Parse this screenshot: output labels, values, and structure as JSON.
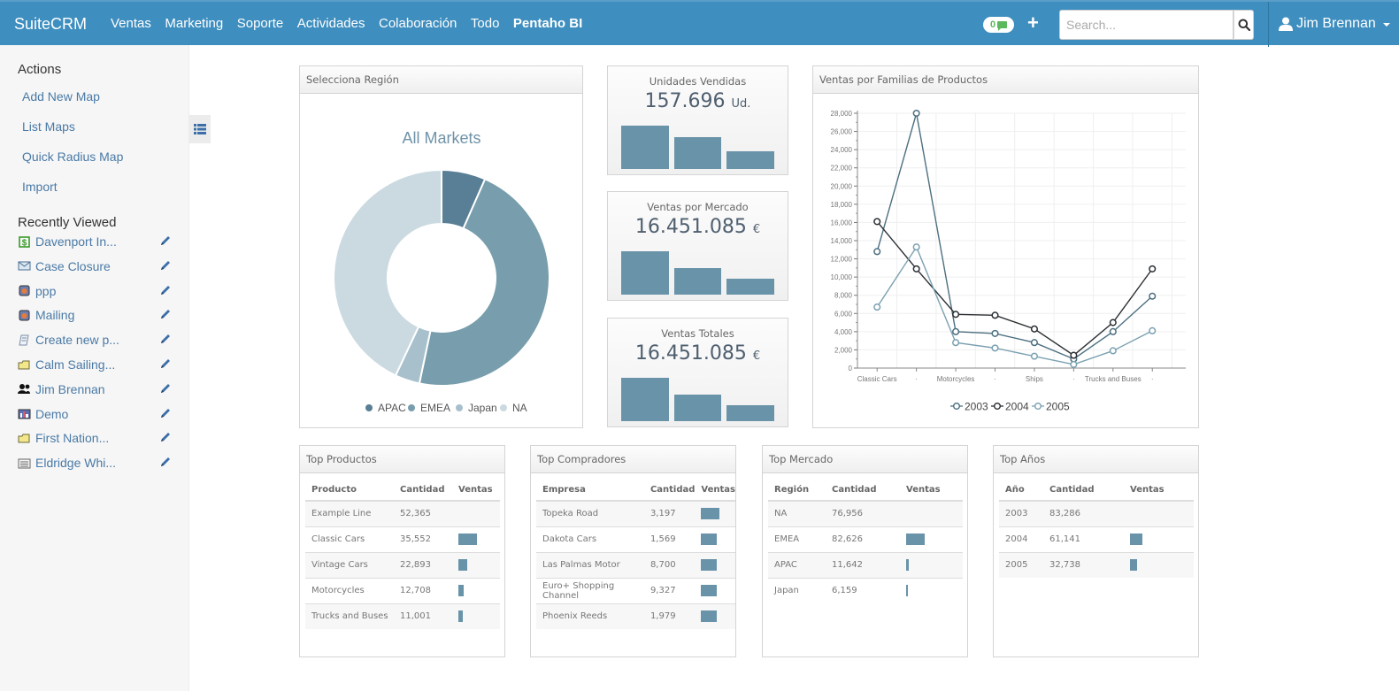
{
  "navbar": {
    "brand": "SuiteCRM",
    "items": [
      "Ventas",
      "Marketing",
      "Soporte",
      "Actividades",
      "Colaboración",
      "Todo",
      "Pentaho BI"
    ],
    "active_item": "Pentaho BI",
    "notification_count": "0",
    "search_placeholder": "Search...",
    "user_name": "Jim Brennan"
  },
  "sidebar": {
    "actions_heading": "Actions",
    "actions": [
      "Add New Map",
      "List Maps",
      "Quick Radius Map",
      "Import"
    ],
    "recent_heading": "Recently Viewed",
    "recent": [
      {
        "label": "Davenport In...",
        "icon": "opportunity-icon"
      },
      {
        "label": "Case Closure",
        "icon": "email-icon"
      },
      {
        "label": "ppp",
        "icon": "campaign-icon"
      },
      {
        "label": "Mailing",
        "icon": "campaign-icon"
      },
      {
        "label": "Create new p...",
        "icon": "document-icon"
      },
      {
        "label": "Calm Sailing...",
        "icon": "project-folder-icon"
      },
      {
        "label": "Jim Brennan",
        "icon": "users-icon"
      },
      {
        "label": "Demo",
        "icon": "report-icon"
      },
      {
        "label": "First Nation...",
        "icon": "project-folder-icon"
      },
      {
        "label": "Eldridge Whi...",
        "icon": "account-icon"
      }
    ]
  },
  "region_panel": {
    "title": "Selecciona Región",
    "chart_title": "All Markets"
  },
  "kpis": [
    {
      "title": "Unidades Vendidas",
      "value": "157.696",
      "unit": "Ud.",
      "bars": [
        0.74,
        0.54,
        0.31
      ]
    },
    {
      "title": "Ventas por Mercado",
      "value": "16.451.085",
      "unit": "€",
      "bars": [
        0.74,
        0.45,
        0.27
      ]
    },
    {
      "title": "Ventas Totales",
      "value": "16.451.085",
      "unit": "€",
      "bars": [
        0.74,
        0.45,
        0.27
      ]
    }
  ],
  "line_panel": {
    "title": "Ventas por Familias de Productos"
  },
  "chart_data": [
    {
      "type": "pie",
      "title": "All Markets",
      "donut": true,
      "categories": [
        "APAC",
        "EMEA",
        "Japan",
        "NA"
      ],
      "values": [
        6.6,
        46.7,
        3.7,
        43.0
      ],
      "colors": [
        "#587f95",
        "#789ead",
        "#a7c0cc",
        "#cbdae1"
      ],
      "legend": "bottom"
    },
    {
      "type": "line",
      "title": "Ventas por Familias de Productos",
      "x": [
        "Classic Cars",
        "·",
        "Motorcycles",
        "·",
        "Ships",
        "·",
        "Trucks and Buses",
        "·"
      ],
      "ylim": [
        0,
        28000
      ],
      "yticks": [
        0,
        2000,
        4000,
        6000,
        8000,
        10000,
        12000,
        14000,
        16000,
        18000,
        20000,
        22000,
        24000,
        26000,
        28000
      ],
      "grid": true,
      "legend": "bottom",
      "series": [
        {
          "name": "2003",
          "color": "#4d6f80",
          "values": [
            12800,
            28000,
            4000,
            3800,
            2800,
            1000,
            4000,
            7900
          ]
        },
        {
          "name": "2004",
          "color": "#2b2f33",
          "values": [
            16100,
            10900,
            5900,
            5800,
            4300,
            1400,
            5000,
            10900
          ]
        },
        {
          "name": "2005",
          "color": "#7ba1b1",
          "values": [
            6700,
            13300,
            2800,
            2200,
            1300,
            400,
            1900,
            4100
          ]
        }
      ]
    }
  ],
  "tables": [
    {
      "title": "Top Productos",
      "columns": [
        "Producto",
        "Cantidad",
        "Ventas"
      ],
      "rows": [
        {
          "name": "Example Line",
          "qty": "52,365",
          "bar": 0
        },
        {
          "name": "Classic Cars",
          "qty": "35,552",
          "bar": 0.95
        },
        {
          "name": "Vintage Cars",
          "qty": "22,893",
          "bar": 0.45
        },
        {
          "name": "Motorcycles",
          "qty": "12,708",
          "bar": 0.25
        },
        {
          "name": "Trucks and Buses",
          "qty": "11,001",
          "bar": 0.22
        }
      ]
    },
    {
      "title": "Top Compradores",
      "columns": [
        "Empresa",
        "Cantidad",
        "Ventas"
      ],
      "rows": [
        {
          "name": "Topeka Road",
          "qty": "3,197",
          "bar": 0.95
        },
        {
          "name": "Dakota Cars",
          "qty": "1,569",
          "bar": 0.8
        },
        {
          "name": "Las Palmas Motor",
          "qty": "8,700",
          "bar": 0.8
        },
        {
          "name": "Euro+ Shopping Channel",
          "qty": "9,327",
          "bar": 0.8
        },
        {
          "name": "Phoenix Reeds",
          "qty": "1,979",
          "bar": 0.8
        }
      ]
    },
    {
      "title": "Top Mercado",
      "columns": [
        "Región",
        "Cantidad",
        "Ventas"
      ],
      "rows": [
        {
          "name": "NA",
          "qty": "76,956",
          "bar": 0
        },
        {
          "name": "EMEA",
          "qty": "82,626",
          "bar": 0.95
        },
        {
          "name": "APAC",
          "qty": "11,642",
          "bar": 0.12
        },
        {
          "name": "Japan",
          "qty": "6,159",
          "bar": 0.05
        }
      ]
    },
    {
      "title": "Top Años",
      "columns": [
        "Año",
        "Cantidad",
        "Ventas"
      ],
      "rows": [
        {
          "name": "2003",
          "qty": "83,286",
          "bar": 0
        },
        {
          "name": "2004",
          "qty": "61,141",
          "bar": 0.65
        },
        {
          "name": "2005",
          "qty": "32,738",
          "bar": 0.37
        }
      ]
    }
  ]
}
